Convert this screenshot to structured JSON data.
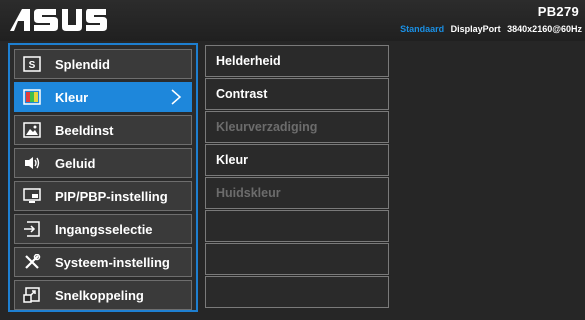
{
  "header": {
    "brand": "ASUS",
    "model": "PB279",
    "status": {
      "mode": "Standaard",
      "input": "DisplayPort",
      "resolution": "3840x2160@60Hz"
    }
  },
  "colors": {
    "accent": "#1e87db",
    "mode_text": "#1a8fe3",
    "background": "#262626",
    "disabled_text": "#6c6c6c"
  },
  "sidebar": {
    "items": [
      {
        "label": "Splendid",
        "icon": "splendid-s-icon"
      },
      {
        "label": "Kleur",
        "icon": "color-bars-icon",
        "active": true
      },
      {
        "label": "Beeldinst",
        "icon": "picture-icon"
      },
      {
        "label": "Geluid",
        "icon": "speaker-icon"
      },
      {
        "label": "PIP/PBP-instelling",
        "icon": "pip-icon"
      },
      {
        "label": "Ingangsselectie",
        "icon": "input-select-icon"
      },
      {
        "label": "Systeem-instelling",
        "icon": "tools-icon"
      },
      {
        "label": "Snelkoppeling",
        "icon": "shortcut-icon"
      }
    ]
  },
  "submenu": {
    "items": [
      {
        "label": "Helderheid",
        "enabled": true
      },
      {
        "label": "Contrast",
        "enabled": true
      },
      {
        "label": "Kleurverzadiging",
        "enabled": false
      },
      {
        "label": "Kleur",
        "enabled": true
      },
      {
        "label": "Huidskleur",
        "enabled": false
      },
      {
        "label": "",
        "enabled": true
      },
      {
        "label": "",
        "enabled": true
      },
      {
        "label": "",
        "enabled": true
      }
    ]
  }
}
